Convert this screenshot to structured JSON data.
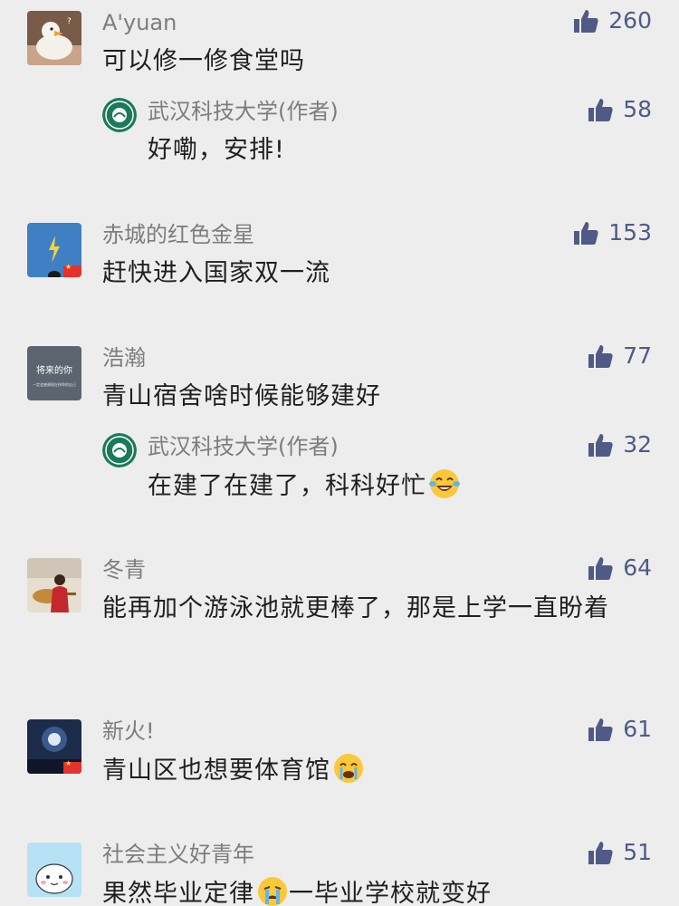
{
  "colors": {
    "background": "#ededed",
    "name": "#7d7d7d",
    "text": "#1f1f1f",
    "like": "#4f5b86"
  },
  "comments": [
    {
      "author": "A'yuan",
      "text": "可以修一修食堂吗",
      "likes": "260",
      "reply": {
        "author": "武汉科技大学(作者)",
        "text": "好嘞，安排!",
        "likes": "58"
      }
    },
    {
      "author": "赤城的红色金星",
      "text": "赶快进入国家双一流",
      "likes": "153"
    },
    {
      "author": "浩瀚",
      "text": "青山宿舍啥时候能够建好",
      "likes": "77",
      "avatar_text": {
        "line1": "将来的你",
        "line2": "一定会感谢现在拼命的自己"
      },
      "reply": {
        "author": "武汉科技大学(作者)",
        "text": "在建了在建了，科科好忙",
        "likes": "32",
        "emoji": "laughing-tears-emoji"
      }
    },
    {
      "author": "冬青",
      "text": "能再加个游泳池就更棒了，那是上学一直盼着",
      "likes": "64"
    },
    {
      "author": "新火!",
      "text": "青山区也想要体育馆",
      "likes": "61",
      "emoji": "crying-emoji"
    },
    {
      "author": "社会主义好青年",
      "text_before": "果然毕业定律",
      "text_after": "一毕业学校就变好",
      "likes": "51",
      "emoji": "sobbing-emoji"
    }
  ]
}
